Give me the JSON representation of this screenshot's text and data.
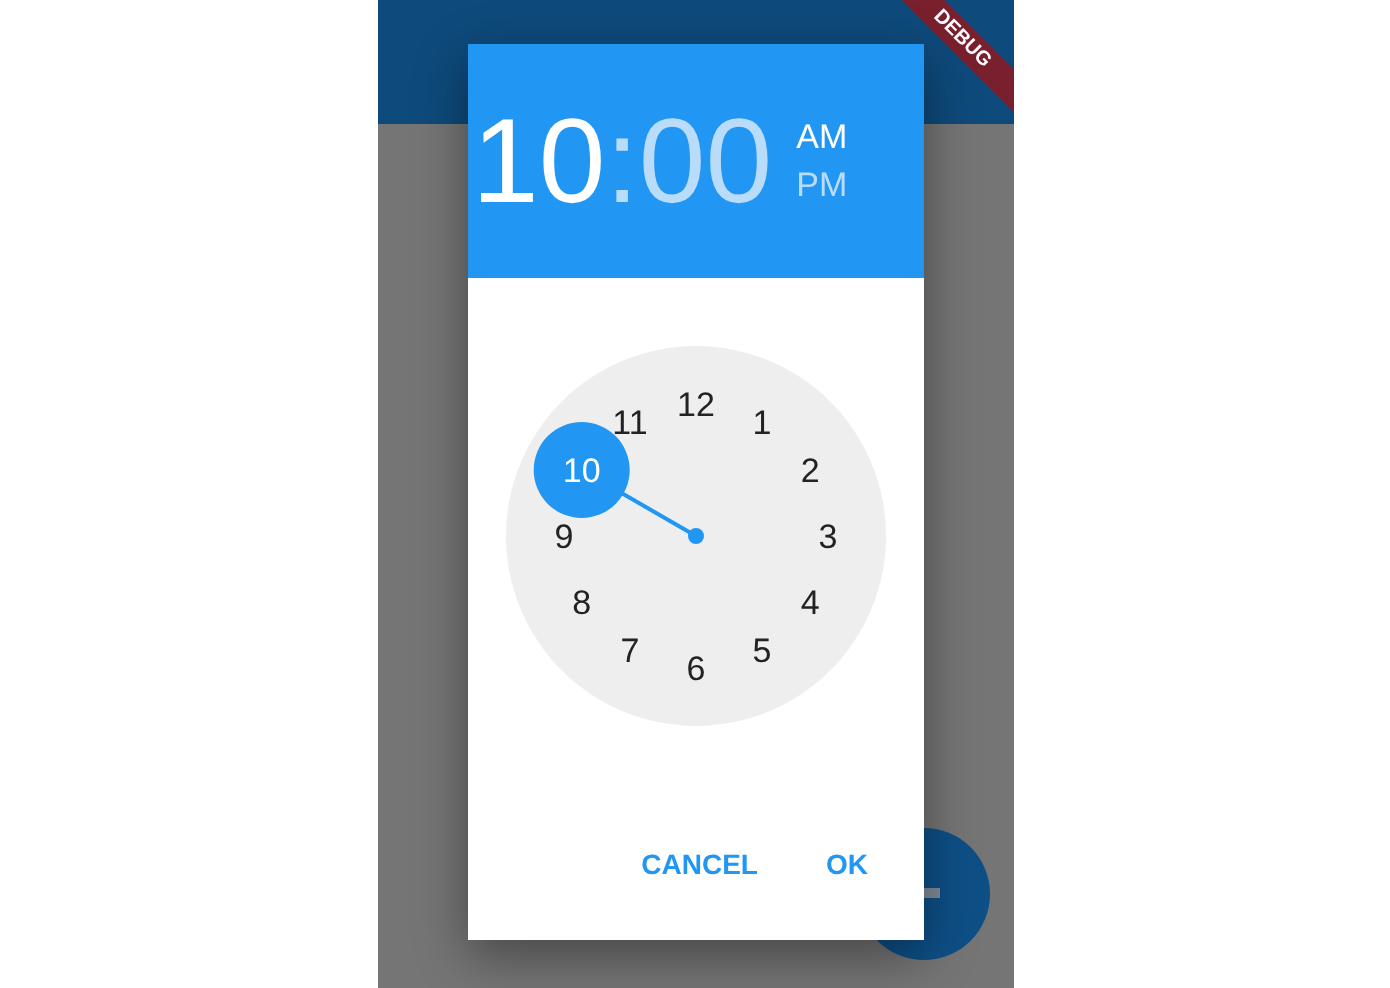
{
  "debug_banner": "DEBUG",
  "time_picker": {
    "hour": {
      "text": "10",
      "selected": true
    },
    "separator": ":",
    "minute": {
      "text": "00",
      "selected": false
    },
    "periods": [
      {
        "label": "AM",
        "selected": true
      },
      {
        "label": "PM",
        "selected": false
      }
    ],
    "dial": [
      {
        "label": "12",
        "selected": false
      },
      {
        "label": "1",
        "selected": false
      },
      {
        "label": "2",
        "selected": false
      },
      {
        "label": "3",
        "selected": false
      },
      {
        "label": "4",
        "selected": false
      },
      {
        "label": "5",
        "selected": false
      },
      {
        "label": "6",
        "selected": false
      },
      {
        "label": "7",
        "selected": false
      },
      {
        "label": "8",
        "selected": false
      },
      {
        "label": "9",
        "selected": false
      },
      {
        "label": "10",
        "selected": true
      },
      {
        "label": "11",
        "selected": false
      }
    ],
    "buttons": [
      "CANCEL",
      "OK"
    ]
  }
}
